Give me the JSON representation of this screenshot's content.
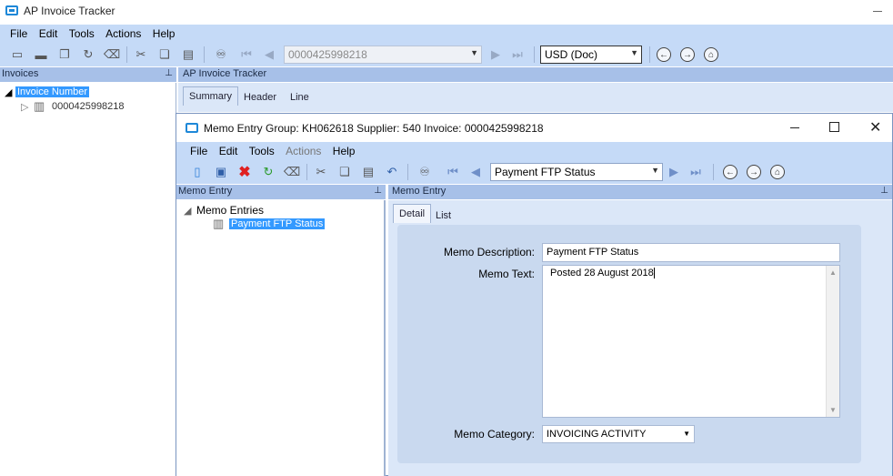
{
  "main_window": {
    "title": "AP Invoice Tracker",
    "menu": [
      "File",
      "Edit",
      "Tools",
      "Actions",
      "Help"
    ],
    "record_combo": "0000425998218",
    "currency_combo": "USD (Doc)",
    "invoices_pane_title": "Invoices",
    "tree_root": "Invoice Number",
    "tree_child": "0000425998218",
    "content_title": "AP Invoice Tracker",
    "tabs": [
      "Summary",
      "Header",
      "Line"
    ]
  },
  "memo_window": {
    "title": "Memo Entry Group: KH062618 Supplier: 540 Invoice: 0000425998218",
    "menu": [
      "File",
      "Edit",
      "Tools",
      "Actions",
      "Help"
    ],
    "record_combo": "Payment FTP Status",
    "left_pane_title": "Memo Entry",
    "right_pane_title": "Memo Entry",
    "tree_root": "Memo Entries",
    "tree_child": "Payment FTP Status",
    "tabs": [
      "Detail",
      "List"
    ],
    "form": {
      "description_label": "Memo Description:",
      "description_value": "Payment FTP Status",
      "text_label": "Memo Text:",
      "text_value": "Posted 28 August 2018",
      "category_label": "Memo Category:",
      "category_value": "INVOICING ACTIVITY"
    }
  },
  "colors": {
    "toolbar_bg": "#c5daf7",
    "pane_header": "#a7c0e8",
    "selection": "#3399ff",
    "panel_bg": "#c9d9ef"
  }
}
